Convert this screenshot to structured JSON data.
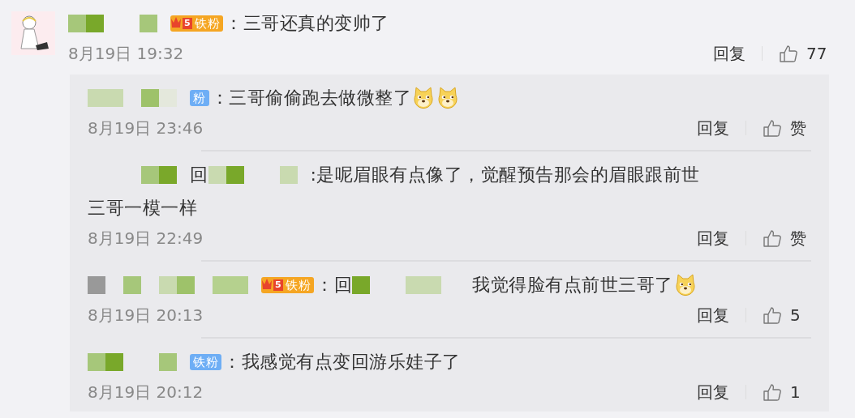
{
  "comment": {
    "parts": [
      {
        "kind": "mosaic"
      },
      {
        "kind": "crown-badge",
        "rank": "5",
        "text": "铁粉"
      },
      {
        "kind": "text",
        "text": "：三哥还真的变帅了"
      }
    ],
    "time": "8月19日 19:32",
    "reply_label": "回复",
    "likes": "77"
  },
  "replies": [
    {
      "parts": [
        {
          "kind": "mosaic"
        },
        {
          "kind": "badge",
          "text": "粉"
        },
        {
          "kind": "text",
          "text": "：三哥偷偷跑去做微整了"
        },
        {
          "kind": "emoji"
        },
        {
          "kind": "emoji"
        }
      ],
      "time": "8月19日 23:46",
      "reply_label": "回复",
      "likes": "赞"
    },
    {
      "parts": [
        {
          "kind": "mosaic"
        },
        {
          "kind": "text",
          "text": "回"
        },
        {
          "kind": "mosaic"
        },
        {
          "kind": "text",
          "text": ":是呢眉眼有点像了，觉醒预告那会的眉眼跟前世"
        },
        {
          "kind": "wrapped-text",
          "text": "三哥一模一样"
        }
      ],
      "time": "8月19日 22:49",
      "reply_label": "回复",
      "likes": "赞"
    },
    {
      "parts": [
        {
          "kind": "mosaic"
        },
        {
          "kind": "crown-badge",
          "rank": "5",
          "text": "铁粉"
        },
        {
          "kind": "text",
          "text": "：回"
        },
        {
          "kind": "mosaic"
        },
        {
          "kind": "text",
          "text": "我觉得脸有点前世三哥了"
        },
        {
          "kind": "emoji"
        }
      ],
      "time": "8月19日 20:13",
      "reply_label": "回复",
      "likes": "5"
    },
    {
      "parts": [
        {
          "kind": "mosaic"
        },
        {
          "kind": "badge",
          "text": "铁粉"
        },
        {
          "kind": "text",
          "text": "：我感觉有点变回游乐娃子了"
        }
      ],
      "time": "8月19日 20:12",
      "reply_label": "回复",
      "likes": "1"
    }
  ]
}
